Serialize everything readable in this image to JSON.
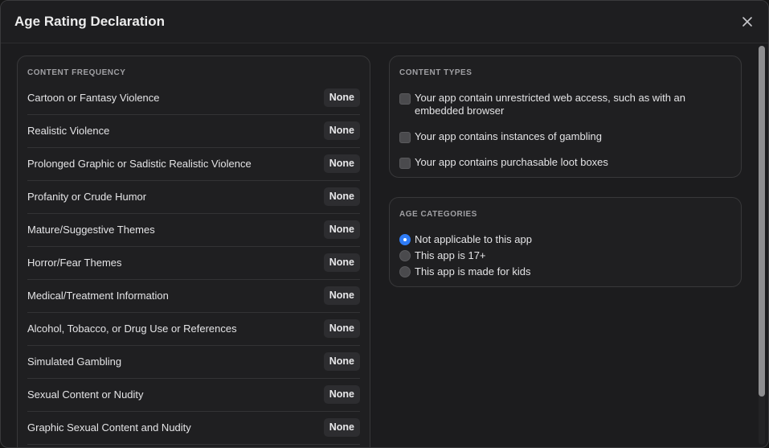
{
  "dialog": {
    "title": "Age Rating Declaration",
    "close_icon": "close-icon"
  },
  "content_frequency": {
    "heading": "CONTENT FREQUENCY",
    "items": [
      {
        "label": "Cartoon or Fantasy Violence",
        "value": "None"
      },
      {
        "label": "Realistic Violence",
        "value": "None"
      },
      {
        "label": "Prolonged Graphic or Sadistic Realistic Violence",
        "value": "None"
      },
      {
        "label": "Profanity or Crude Humor",
        "value": "None"
      },
      {
        "label": "Mature/Suggestive Themes",
        "value": "None"
      },
      {
        "label": "Horror/Fear Themes",
        "value": "None"
      },
      {
        "label": "Medical/Treatment Information",
        "value": "None"
      },
      {
        "label": "Alcohol, Tobacco, or Drug Use or References",
        "value": "None"
      },
      {
        "label": "Simulated Gambling",
        "value": "None"
      },
      {
        "label": "Sexual Content or Nudity",
        "value": "None"
      },
      {
        "label": "Graphic Sexual Content and Nudity",
        "value": "None"
      }
    ]
  },
  "content_types": {
    "heading": "CONTENT TYPES",
    "items": [
      {
        "label": "Your app contain unrestricted web access, such as with an embedded browser",
        "checked": false
      },
      {
        "label": "Your app contains instances of gambling",
        "checked": false
      },
      {
        "label": "Your app contains purchasable loot boxes",
        "checked": false
      }
    ]
  },
  "age_categories": {
    "heading": "AGE CATEGORIES",
    "options": [
      {
        "label": "Not applicable to this app",
        "selected": true
      },
      {
        "label": "This app is 17+",
        "selected": false
      },
      {
        "label": "This app is made for kids",
        "selected": false
      }
    ]
  },
  "colors": {
    "accent": "#2f7cf6",
    "background": "#1c1c1e"
  }
}
